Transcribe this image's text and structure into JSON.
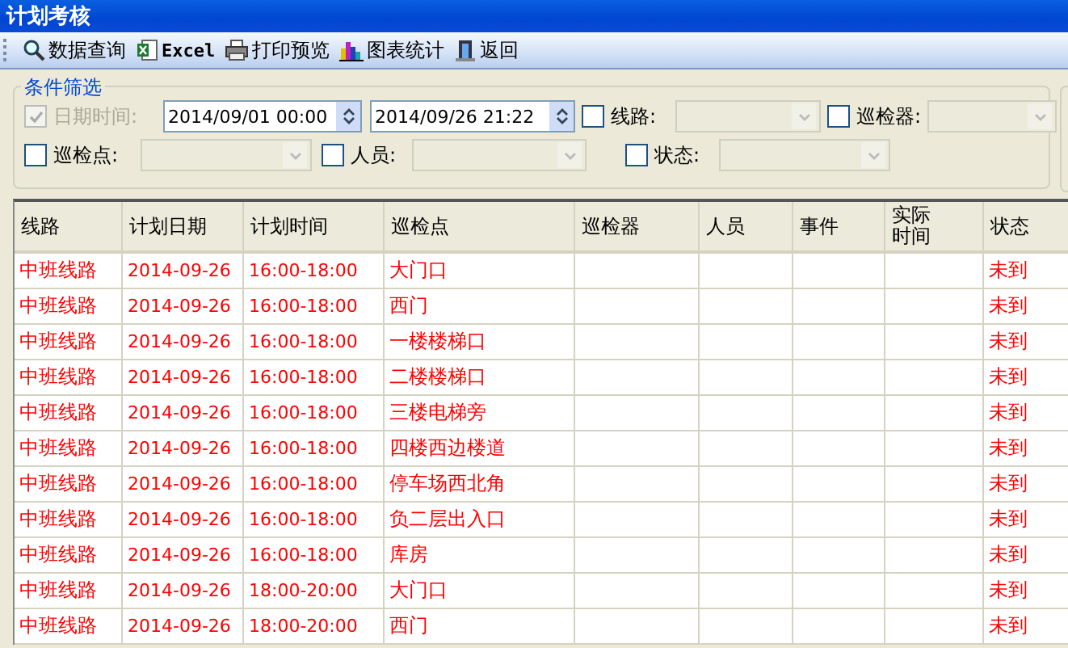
{
  "window": {
    "title": "计划考核"
  },
  "toolbar": [
    {
      "label": "数据查询",
      "kind": "search"
    },
    {
      "label": "Excel",
      "kind": "excel"
    },
    {
      "label": "打印预览",
      "kind": "print"
    },
    {
      "label": "图表统计",
      "kind": "chart"
    },
    {
      "label": "返回",
      "kind": "back"
    }
  ],
  "filter": {
    "title": "条件筛选",
    "fields": [
      {
        "kind": "datetime",
        "label": "日期时间:",
        "checked": true,
        "disabled": true,
        "from": "2014/09/01 00:00",
        "to": "2014/09/26 21:22"
      },
      {
        "kind": "combo",
        "label": "线路:",
        "checked": false,
        "disabled": false
      },
      {
        "kind": "combo",
        "label": "巡检器:",
        "checked": false,
        "disabled": false
      },
      {
        "kind": "combo",
        "label": "巡检点:",
        "checked": false,
        "disabled": false
      },
      {
        "kind": "combo",
        "label": "人员:",
        "checked": false,
        "disabled": false
      },
      {
        "kind": "combo",
        "label": "状态:",
        "checked": false,
        "disabled": false
      }
    ]
  },
  "table": {
    "columns": [
      "线路",
      "计划日期",
      "计划时间",
      "巡检点",
      "巡检器",
      "人员",
      "事件",
      "实际时间",
      "状态"
    ],
    "rows": [
      [
        "中班线路",
        "2014-09-26",
        "16:00-18:00",
        "大门口",
        "",
        "",
        "",
        "",
        "未到"
      ],
      [
        "中班线路",
        "2014-09-26",
        "16:00-18:00",
        "西门",
        "",
        "",
        "",
        "",
        "未到"
      ],
      [
        "中班线路",
        "2014-09-26",
        "16:00-18:00",
        "一楼楼梯口",
        "",
        "",
        "",
        "",
        "未到"
      ],
      [
        "中班线路",
        "2014-09-26",
        "16:00-18:00",
        "二楼楼梯口",
        "",
        "",
        "",
        "",
        "未到"
      ],
      [
        "中班线路",
        "2014-09-26",
        "16:00-18:00",
        "三楼电梯旁",
        "",
        "",
        "",
        "",
        "未到"
      ],
      [
        "中班线路",
        "2014-09-26",
        "16:00-18:00",
        "四楼西边楼道",
        "",
        "",
        "",
        "",
        "未到"
      ],
      [
        "中班线路",
        "2014-09-26",
        "16:00-18:00",
        "停车场西北角",
        "",
        "",
        "",
        "",
        "未到"
      ],
      [
        "中班线路",
        "2014-09-26",
        "16:00-18:00",
        "负二层出入口",
        "",
        "",
        "",
        "",
        "未到"
      ],
      [
        "中班线路",
        "2014-09-26",
        "16:00-18:00",
        "库房",
        "",
        "",
        "",
        "",
        "未到"
      ],
      [
        "中班线路",
        "2014-09-26",
        "18:00-20:00",
        "大门口",
        "",
        "",
        "",
        "",
        "未到"
      ],
      [
        "中班线路",
        "2014-09-26",
        "18:00-20:00",
        "西门",
        "",
        "",
        "",
        "",
        "未到"
      ]
    ]
  }
}
